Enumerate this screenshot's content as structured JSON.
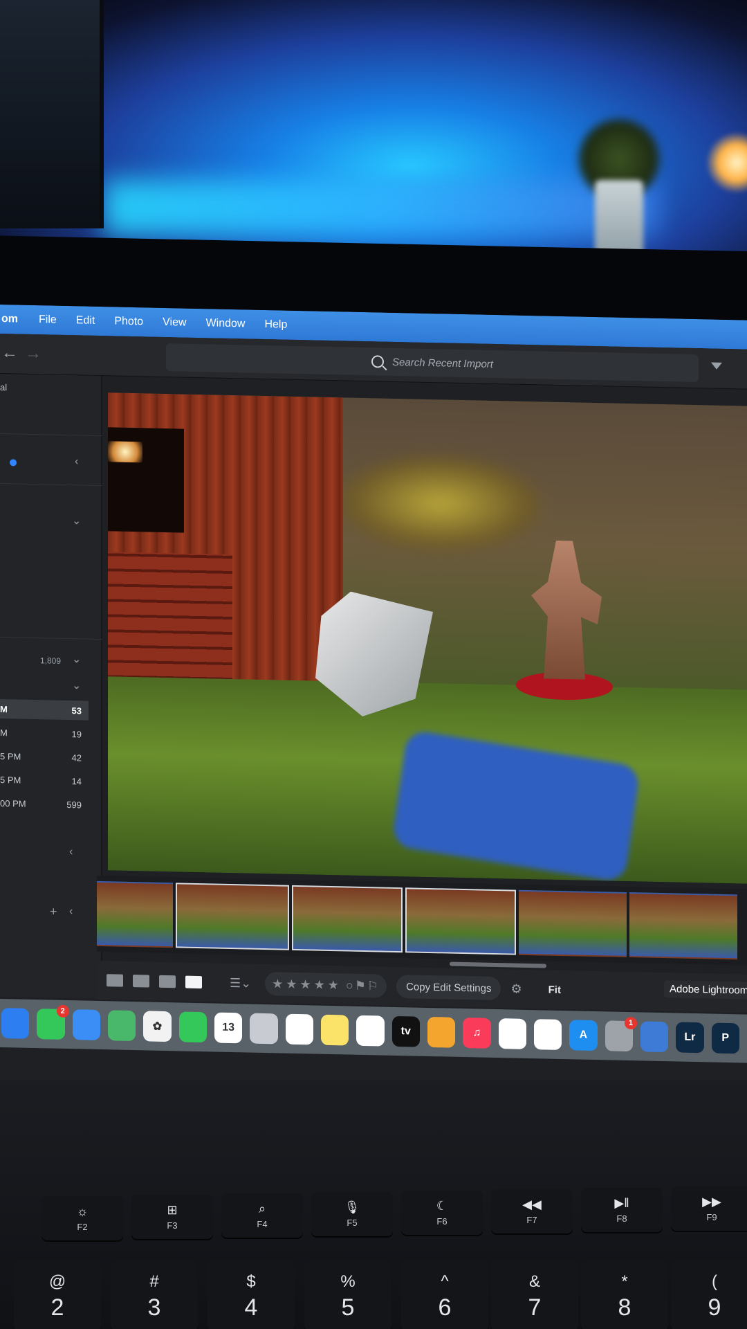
{
  "menubar": {
    "app_name": "om",
    "items": [
      "File",
      "Edit",
      "Photo",
      "View",
      "Window",
      "Help"
    ]
  },
  "toolbar": {
    "back_glyph": "←",
    "forward_glyph": "→",
    "search_placeholder": "Search Recent Import"
  },
  "left_panel": {
    "label": "al",
    "collapse_glyph": "‹",
    "count_total": "1,809",
    "rows": [
      {
        "time": "M",
        "count": "53",
        "selected": true
      },
      {
        "time": "M",
        "count": "19"
      },
      {
        "time": "5 PM",
        "count": "42"
      },
      {
        "time": "5 PM",
        "count": "14"
      },
      {
        "time": "00 PM",
        "count": "599"
      }
    ],
    "add_glyph": "+"
  },
  "bottom_bar": {
    "stars": "★★★★★",
    "copy_label": "Copy Edit Settings",
    "fit_label": "Fit",
    "tooltip": "Adobe Lightroom"
  },
  "dock": {
    "icons": [
      {
        "name": "finder-icon",
        "color": "#2d7ef0",
        "glyph": ""
      },
      {
        "name": "messages-icon",
        "color": "#34c759",
        "glyph": "",
        "badge": "2"
      },
      {
        "name": "mail-icon",
        "color": "#3a8ef5",
        "glyph": ""
      },
      {
        "name": "maps-icon",
        "color": "#49b86a",
        "glyph": ""
      },
      {
        "name": "photos-icon",
        "color": "#f2f2f2",
        "glyph": "✿"
      },
      {
        "name": "facetime-icon",
        "color": "#34c759",
        "glyph": ""
      },
      {
        "name": "calendar-icon",
        "color": "#ffffff",
        "glyph": "13"
      },
      {
        "name": "contacts-icon",
        "color": "#c8ccd2",
        "glyph": ""
      },
      {
        "name": "reminders-icon",
        "color": "#ffffff",
        "glyph": ""
      },
      {
        "name": "notes-icon",
        "color": "#fbe36a",
        "glyph": ""
      },
      {
        "name": "freeform-icon",
        "color": "#ffffff",
        "glyph": ""
      },
      {
        "name": "tv-icon",
        "color": "#111111",
        "glyph": "tv"
      },
      {
        "name": "books-icon",
        "color": "#f4a52e",
        "glyph": ""
      },
      {
        "name": "music-icon",
        "color": "#fa3c5a",
        "glyph": "♫"
      },
      {
        "name": "news-icon",
        "color": "#ffffff",
        "glyph": ""
      },
      {
        "name": "safari-icon",
        "color": "#ffffff",
        "glyph": ""
      },
      {
        "name": "appstore-icon",
        "color": "#1f8ef1",
        "glyph": "A"
      },
      {
        "name": "settings-icon",
        "color": "#9ea3aa",
        "glyph": "",
        "badge": "1"
      },
      {
        "name": "files-icon",
        "color": "#3d7bd6",
        "glyph": ""
      },
      {
        "name": "lightroom-icon",
        "color": "#0f2a45",
        "glyph": "Lr"
      },
      {
        "name": "photoshop-icon",
        "color": "#0f2a45",
        "glyph": "P"
      }
    ]
  },
  "keyboard": {
    "fkeys": [
      {
        "sym": "☼",
        "label": "F2"
      },
      {
        "sym": "⊞",
        "label": "F3"
      },
      {
        "sym": "⌕",
        "label": "F4"
      },
      {
        "sym": "🎙",
        "label": "F5"
      },
      {
        "sym": "☾",
        "label": "F6"
      },
      {
        "sym": "◀◀",
        "label": "F7"
      },
      {
        "sym": "▶‖",
        "label": "F8"
      },
      {
        "sym": "▶▶",
        "label": "F9"
      }
    ],
    "numkeys": [
      {
        "top": "@",
        "bot": "2"
      },
      {
        "top": "#",
        "bot": "3"
      },
      {
        "top": "$",
        "bot": "4"
      },
      {
        "top": "%",
        "bot": "5"
      },
      {
        "top": "^",
        "bot": "6"
      },
      {
        "top": "&",
        "bot": "7"
      },
      {
        "top": "*",
        "bot": "8"
      },
      {
        "top": "(",
        "bot": "9"
      }
    ]
  }
}
